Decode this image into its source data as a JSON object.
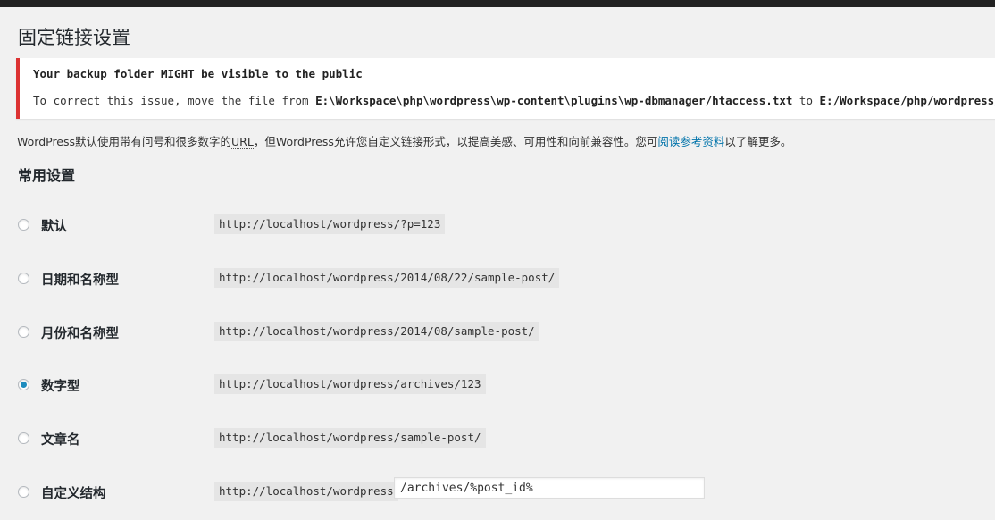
{
  "page": {
    "title": "固定链接设置"
  },
  "notice": {
    "title": "Your backup folder MIGHT be visible to the public",
    "body_prefix": "To correct this issue, move the file from ",
    "from_path": "E:\\Workspace\\php\\wordpress\\wp-content\\plugins\\wp-dbmanager/htaccess.txt",
    "to_text": " to ",
    "to_path": "E:/Workspace/php/wordpress/wp-content/backup-db/.htaccess"
  },
  "intro": {
    "part1": "WordPress默认使用带有问号和很多数字的",
    "abbr": "URL",
    "part2": "，但WordPress允许您自定义链接形式，以提高美感、可用性和向前兼容性。您可",
    "link": "阅读参考资料",
    "part3": "以了解更多。"
  },
  "section": {
    "title": "常用设置"
  },
  "options": [
    {
      "label": "默认",
      "example": "http://localhost/wordpress/?p=123",
      "checked": false
    },
    {
      "label": "日期和名称型",
      "example": "http://localhost/wordpress/2014/08/22/sample-post/",
      "checked": false
    },
    {
      "label": "月份和名称型",
      "example": "http://localhost/wordpress/2014/08/sample-post/",
      "checked": false
    },
    {
      "label": "数字型",
      "example": "http://localhost/wordpress/archives/123",
      "checked": true
    },
    {
      "label": "文章名",
      "example": "http://localhost/wordpress/sample-post/",
      "checked": false
    },
    {
      "label": "自定义结构",
      "example": "http://localhost/wordpress",
      "checked": false,
      "input_value": "/archives/%post_id%"
    }
  ],
  "colors": {
    "notice_border": "#dc3232",
    "link": "#0073aa",
    "radio_checked": "#1e8cbe"
  }
}
